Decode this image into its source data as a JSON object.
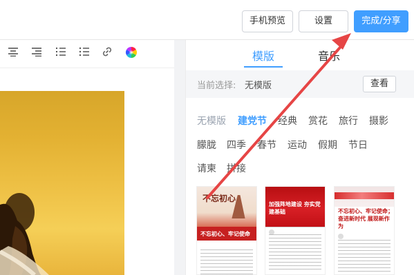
{
  "header": {
    "buttons": {
      "preview": "手机预览",
      "settings": "设置",
      "done_share": "完成/分享"
    }
  },
  "editor": {
    "toolbar": {
      "icons": [
        "align-center-icon",
        "align-right-icon",
        "ordered-list-icon",
        "unordered-list-icon",
        "link-icon",
        "color-palette-icon"
      ]
    }
  },
  "template_panel": {
    "tabs": [
      "模版",
      "音乐"
    ],
    "active_tab": "模版",
    "current": {
      "label": "当前选择:",
      "value": "无模版",
      "view_button": "查看"
    },
    "categories": {
      "row1": [
        "无模版",
        "建党节",
        "经典",
        "赏花",
        "旅行",
        "摄影"
      ],
      "row2": [
        "朦胧",
        "四季",
        "春节",
        "运动",
        "假期",
        "节日"
      ],
      "row3": [
        "请柬",
        "拼接"
      ],
      "active": "建党节"
    },
    "thumbnails": [
      {
        "title": "不忘初心、牢记使命",
        "hero_text": "不忘初心"
      },
      {
        "title": "加强阵地建设 夯实党建基础"
      },
      {
        "title": "不忘初心、牢记使命；奋进新时代 展现新作为"
      }
    ]
  },
  "colors": {
    "primary": "#409eff",
    "accent_red": "#e64545"
  }
}
